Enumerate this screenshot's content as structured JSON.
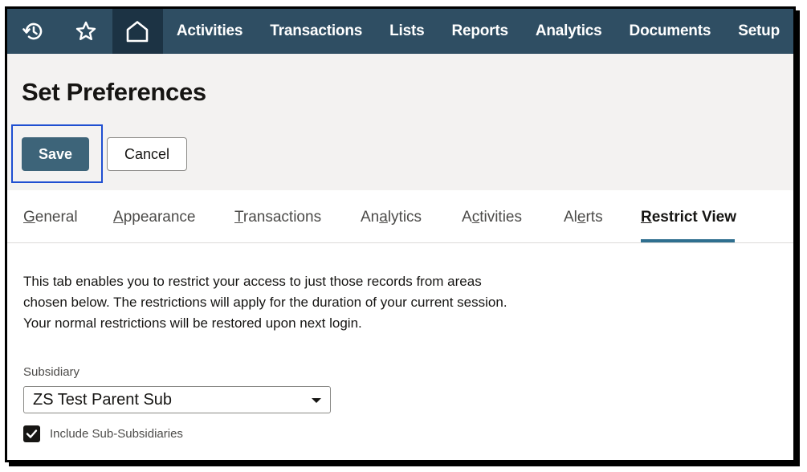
{
  "nav": {
    "icons": [
      "history-icon",
      "star-icon",
      "home-icon"
    ],
    "items": [
      "Activities",
      "Transactions",
      "Lists",
      "Reports",
      "Analytics",
      "Documents",
      "Setup"
    ]
  },
  "header": {
    "title": "Set Preferences",
    "save_label": "Save",
    "cancel_label": "Cancel"
  },
  "tabs": [
    {
      "pre": "",
      "ul": "G",
      "post": "eneral"
    },
    {
      "pre": "",
      "ul": "A",
      "post": "ppearance"
    },
    {
      "pre": "",
      "ul": "T",
      "post": "ransactions"
    },
    {
      "pre": "An",
      "ul": "a",
      "post": "lytics"
    },
    {
      "pre": "A",
      "ul": "c",
      "post": "tivities"
    },
    {
      "pre": "Al",
      "ul": "e",
      "post": "rts"
    },
    {
      "pre": "",
      "ul": "R",
      "post": "estrict View"
    }
  ],
  "content": {
    "description_lines": [
      "This tab enables you to restrict your access to just those records from areas",
      "chosen below. The restrictions will apply for the duration of your current session.",
      "Your normal restrictions will be restored upon next login."
    ],
    "subsidiary_label": "Subsidiary",
    "subsidiary_value": "ZS Test Parent Sub",
    "include_sub_label": "Include Sub-Subsidiaries",
    "include_sub_checked": true
  },
  "colors": {
    "nav_bg": "#2f4e63",
    "primary_button": "#3d6479",
    "active_tab_indicator": "#2f6f8f"
  }
}
